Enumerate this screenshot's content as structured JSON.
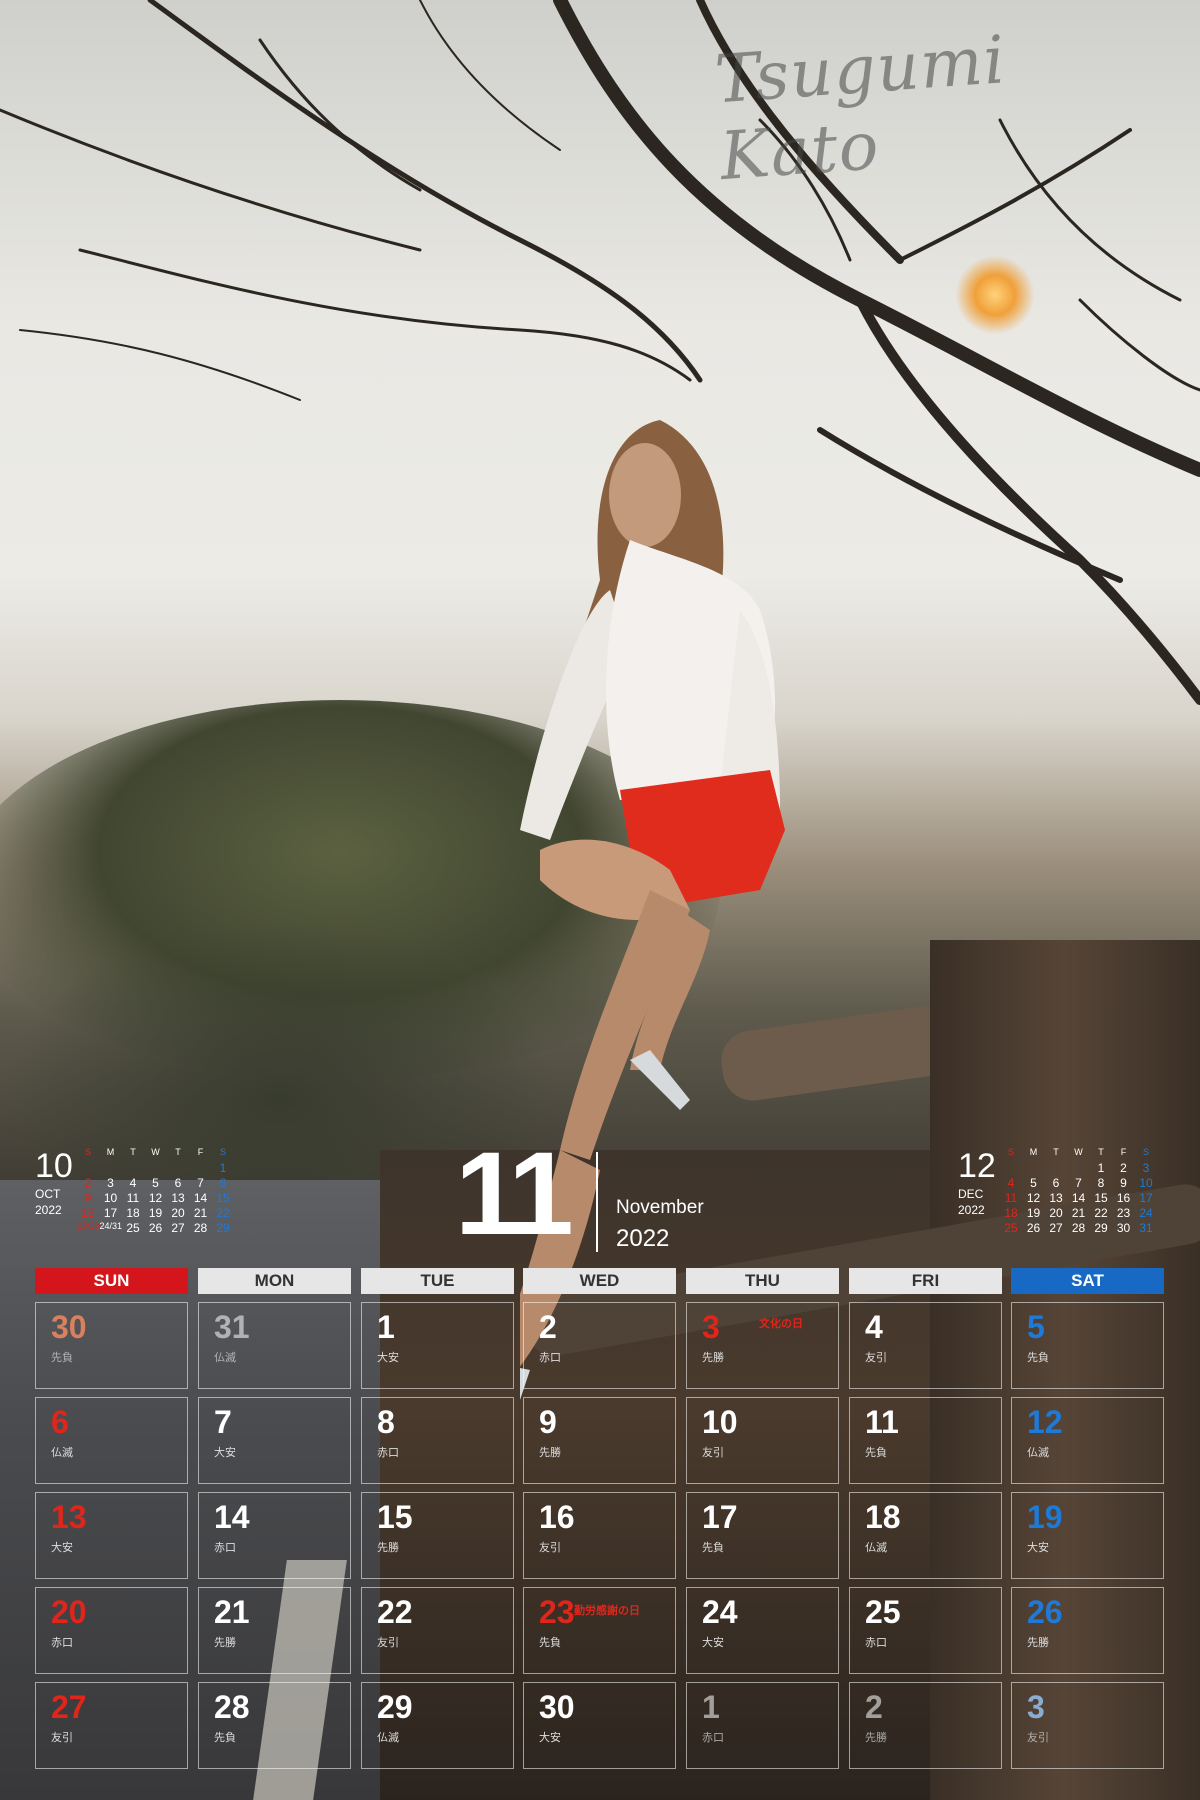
{
  "signature": "Tsugumi Kato",
  "main": {
    "month_number": "11",
    "month_name": "November",
    "year": "2022"
  },
  "prev_month": {
    "number": "10",
    "abbr": "OCT",
    "year": "2022",
    "weekdays": [
      "S",
      "M",
      "T",
      "W",
      "T",
      "F",
      "S"
    ],
    "weeks": [
      [
        "",
        "",
        "",
        "",
        "",
        "",
        "1"
      ],
      [
        "2",
        "3",
        "4",
        "5",
        "6",
        "7",
        "8"
      ],
      [
        "9",
        "10",
        "11",
        "12",
        "13",
        "14",
        "15"
      ],
      [
        "16",
        "17",
        "18",
        "19",
        "20",
        "21",
        "22"
      ],
      [
        "23/30",
        "24/31",
        "25",
        "26",
        "27",
        "28",
        "29"
      ]
    ]
  },
  "next_month": {
    "number": "12",
    "abbr": "DEC",
    "year": "2022",
    "weekdays": [
      "S",
      "M",
      "T",
      "W",
      "T",
      "F",
      "S"
    ],
    "weeks": [
      [
        "",
        "",
        "",
        "",
        "1",
        "2",
        "3"
      ],
      [
        "4",
        "5",
        "6",
        "7",
        "8",
        "9",
        "10"
      ],
      [
        "11",
        "12",
        "13",
        "14",
        "15",
        "16",
        "17"
      ],
      [
        "18",
        "19",
        "20",
        "21",
        "22",
        "23",
        "24"
      ],
      [
        "25",
        "26",
        "27",
        "28",
        "29",
        "30",
        "31"
      ]
    ]
  },
  "weekday_headers": [
    "SUN",
    "MON",
    "TUE",
    "WED",
    "THU",
    "FRI",
    "SAT"
  ],
  "weeks": [
    [
      {
        "day": "30",
        "rokuyo": "先負",
        "other": true
      },
      {
        "day": "31",
        "rokuyo": "仏滅",
        "other": true
      },
      {
        "day": "1",
        "rokuyo": "大安"
      },
      {
        "day": "2",
        "rokuyo": "赤口"
      },
      {
        "day": "3",
        "rokuyo": "先勝",
        "holiday": "文化の日"
      },
      {
        "day": "4",
        "rokuyo": "友引"
      },
      {
        "day": "5",
        "rokuyo": "先負"
      }
    ],
    [
      {
        "day": "6",
        "rokuyo": "仏滅"
      },
      {
        "day": "7",
        "rokuyo": "大安"
      },
      {
        "day": "8",
        "rokuyo": "赤口"
      },
      {
        "day": "9",
        "rokuyo": "先勝"
      },
      {
        "day": "10",
        "rokuyo": "友引"
      },
      {
        "day": "11",
        "rokuyo": "先負"
      },
      {
        "day": "12",
        "rokuyo": "仏滅"
      }
    ],
    [
      {
        "day": "13",
        "rokuyo": "大安"
      },
      {
        "day": "14",
        "rokuyo": "赤口"
      },
      {
        "day": "15",
        "rokuyo": "先勝"
      },
      {
        "day": "16",
        "rokuyo": "友引"
      },
      {
        "day": "17",
        "rokuyo": "先負"
      },
      {
        "day": "18",
        "rokuyo": "仏滅"
      },
      {
        "day": "19",
        "rokuyo": "大安"
      }
    ],
    [
      {
        "day": "20",
        "rokuyo": "赤口"
      },
      {
        "day": "21",
        "rokuyo": "先勝"
      },
      {
        "day": "22",
        "rokuyo": "友引"
      },
      {
        "day": "23",
        "rokuyo": "先負",
        "holiday": "勤労感謝の日"
      },
      {
        "day": "24",
        "rokuyo": "大安"
      },
      {
        "day": "25",
        "rokuyo": "赤口"
      },
      {
        "day": "26",
        "rokuyo": "先勝"
      }
    ],
    [
      {
        "day": "27",
        "rokuyo": "友引"
      },
      {
        "day": "28",
        "rokuyo": "先負"
      },
      {
        "day": "29",
        "rokuyo": "仏滅"
      },
      {
        "day": "30",
        "rokuyo": "大安"
      },
      {
        "day": "1",
        "rokuyo": "赤口",
        "other": true
      },
      {
        "day": "2",
        "rokuyo": "先勝",
        "other": true
      },
      {
        "day": "3",
        "rokuyo": "友引",
        "other": true
      }
    ]
  ],
  "colors": {
    "sunday": "#d4151c",
    "saturday": "#1769c4",
    "holiday": "#e0251b",
    "header_bg": "#e6e6e6"
  }
}
